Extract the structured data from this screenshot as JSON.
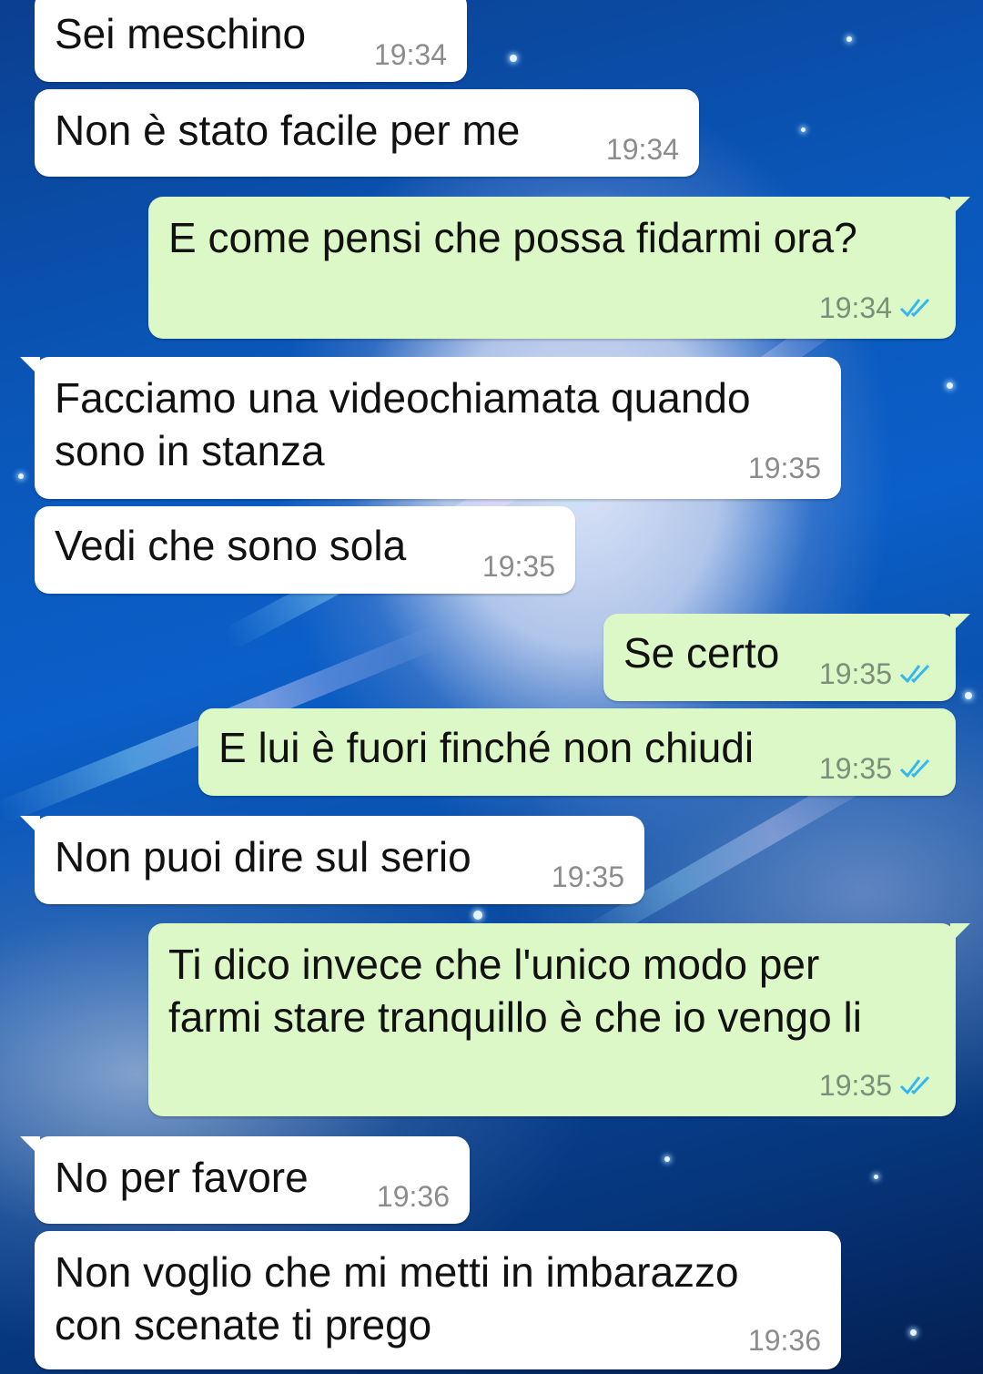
{
  "background": {
    "theme": "night-sky-moon-wallpaper",
    "primary_color": "#0b5fc8",
    "moon_color": "#e8ecfa"
  },
  "colors": {
    "incoming_bubble": "#ffffff",
    "outgoing_bubble": "#dcf8c6",
    "read_ticks": "#34b7f1",
    "timestamp": "#8c8c8c"
  },
  "messages": [
    {
      "direction": "in",
      "text": "Sei meschino",
      "time": "19:34"
    },
    {
      "direction": "in",
      "text": "Non è stato facile per me",
      "time": "19:34"
    },
    {
      "direction": "out",
      "text": "E come pensi che possa fidarmi ora?",
      "time": "19:34",
      "status": "read-double-check-icon"
    },
    {
      "direction": "in",
      "text": "Facciamo una videochiamata quando\nsono in stanza",
      "time": "19:35"
    },
    {
      "direction": "in",
      "text": "Vedi che sono sola",
      "time": "19:35"
    },
    {
      "direction": "out",
      "text": "Se certo",
      "time": "19:35",
      "status": "read-double-check-icon"
    },
    {
      "direction": "out",
      "text": "E lui è fuori finché non chiudi",
      "time": "19:35",
      "status": "read-double-check-icon"
    },
    {
      "direction": "in",
      "text": "Non puoi dire sul serio",
      "time": "19:35"
    },
    {
      "direction": "out",
      "text": "Ti dico invece che l'unico modo per\nfarmi stare tranquillo è che io vengo li",
      "time": "19:35",
      "status": "read-double-check-icon"
    },
    {
      "direction": "in",
      "text": "No per favore",
      "time": "19:36"
    },
    {
      "direction": "in",
      "text": "Non voglio che mi metti in imbarazzo\ncon scenate ti prego",
      "time": "19:36"
    }
  ]
}
